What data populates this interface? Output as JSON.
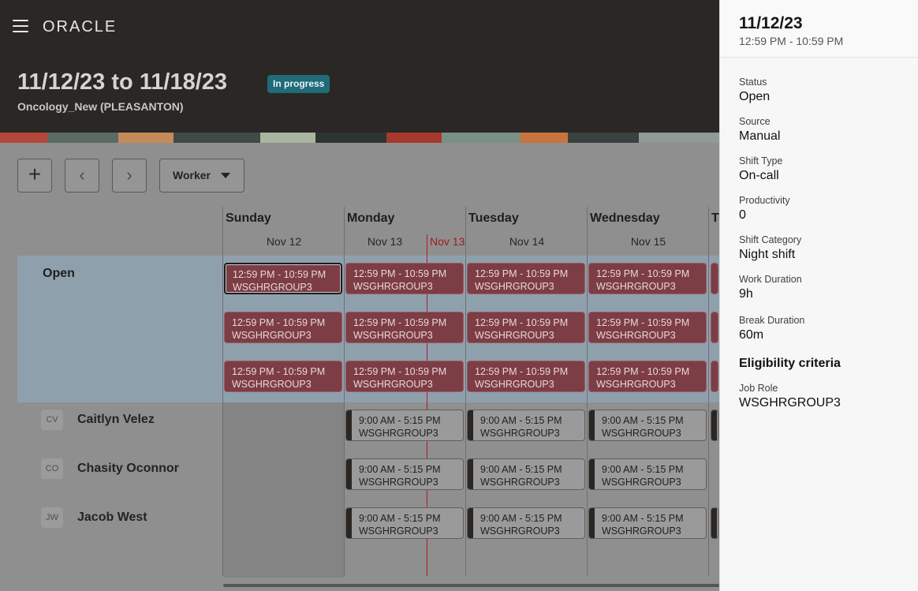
{
  "app": {
    "logo": "ORACLE",
    "menu_icon": "hamburger-menu-icon"
  },
  "header": {
    "period": "11/12/23 to 11/18/23",
    "status_badge": "In progress",
    "location": "Oncology_New (PLEASANTON)"
  },
  "toolbar": {
    "add_label": "+",
    "prev_label": "‹",
    "next_label": "›",
    "view_select": "Worker"
  },
  "days": [
    {
      "name": "Sunday",
      "date": "Nov 12"
    },
    {
      "name": "Monday",
      "date": "Nov 13"
    },
    {
      "name": "Tuesday",
      "date": "Nov 14"
    },
    {
      "name": "Wednesday",
      "date": "Nov 15"
    },
    {
      "name": "T",
      "date": ""
    }
  ],
  "today_marker": "Nov 13",
  "rows": {
    "open_label": "Open",
    "workers": [
      {
        "initials": "CV",
        "name": "Caitlyn Velez"
      },
      {
        "initials": "CO",
        "name": "Chasity Oconnor"
      },
      {
        "initials": "JW",
        "name": "Jacob West"
      }
    ]
  },
  "shifts": {
    "open": {
      "time": "12:59 PM - 10:59 PM",
      "group": "WSGHRGROUP3"
    },
    "assigned": {
      "time": "9:00 AM - 5:15 PM",
      "group": "WSGHRGROUP3"
    }
  },
  "drawer": {
    "date": "11/12/23",
    "time": "12:59 PM - 10:59 PM",
    "fields": [
      {
        "label": "Status",
        "value": "Open"
      },
      {
        "label": "Source",
        "value": "Manual"
      },
      {
        "label": "Shift Type",
        "value": "On-call"
      },
      {
        "label": "Productivity",
        "value": "0"
      },
      {
        "label": "Shift Category",
        "value": "Night shift"
      },
      {
        "label": "Work Duration",
        "value": "9h"
      },
      {
        "label": "Break Duration",
        "value": "60m"
      }
    ],
    "eligibility_title": "Eligibility criteria",
    "job_role": {
      "label": "Job Role",
      "value": "WSGHRGROUP3"
    }
  },
  "colors": {
    "header_bg": "#2a2725",
    "badge_bg": "#1f6b78",
    "open_shift": "#7d3d45",
    "today_line": "#a8211d",
    "drawer_bg": "#f7f7f7"
  }
}
